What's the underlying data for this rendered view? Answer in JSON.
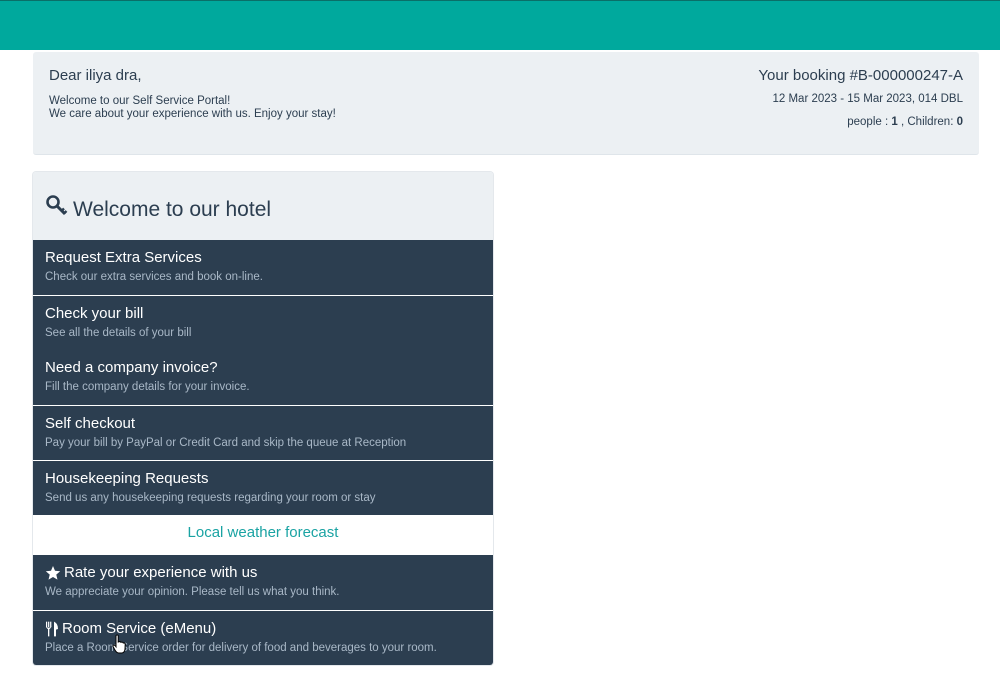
{
  "header": {
    "greeting": "Dear iliya dra,",
    "welcome_line1": "Welcome to our Self Service Portal!",
    "welcome_line2": "We care about your experience with us. Enjoy your stay!",
    "booking_title": "Your booking #B-000000247-A",
    "booking_dates": "12 Mar 2023 - 15 Mar 2023, 014 DBL",
    "people_label": "people : ",
    "people_count": "1",
    "children_label": " , Children: ",
    "children_count": "0"
  },
  "hotel": {
    "title": "Welcome to our hotel",
    "title_icon": "key-icon",
    "items": [
      {
        "title": "Request Extra Services",
        "subtitle": "Check our extra services and book on-line."
      },
      {
        "title": "Check your bill",
        "subtitle": "See all the details of your bill"
      },
      {
        "title": "Need a company invoice?",
        "subtitle": "Fill the company details for your invoice."
      },
      {
        "title": "Self checkout",
        "subtitle": "Pay your bill by PayPal or Credit Card and skip the queue at Reception"
      },
      {
        "title": "Housekeeping Requests",
        "subtitle": "Send us any housekeeping requests regarding your room or stay"
      },
      {
        "title": "Rate your experience with us",
        "subtitle": "We appreciate your opinion. Please tell us what you think.",
        "icon": "star-icon"
      },
      {
        "title": "Room Service (eMenu)",
        "subtitle": "Place a Room Service order for delivery of food and beverages to your room.",
        "icon": "utensils-icon"
      }
    ],
    "weather_link": "Local weather forecast"
  },
  "colors": {
    "topbar": "#00a99d",
    "panel_bg": "#ecf0f3",
    "menu_bg": "#2c3e50",
    "menu_subtitle": "#a9b8c7",
    "link": "#1aa3a3"
  }
}
